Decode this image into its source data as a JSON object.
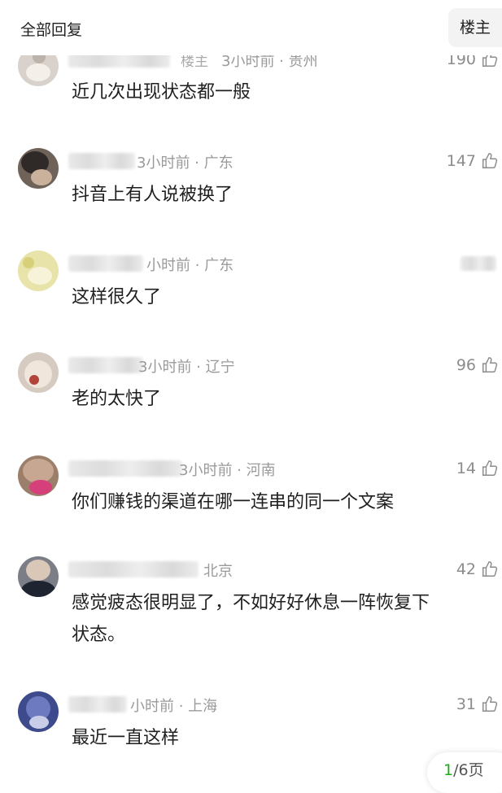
{
  "header": {
    "title": "全部回复",
    "owner_button": "楼主"
  },
  "comments": [
    {
      "badge": "楼主",
      "meta": "3小时前 · 贵州",
      "text": "近几次出现状态都一般",
      "likes": "190"
    },
    {
      "meta": "3小时前 · 广东",
      "text": "抖音上有人说被换了",
      "likes": "147"
    },
    {
      "meta": "小时前 · 广东",
      "text": "这样很久了",
      "likes": ""
    },
    {
      "meta": "3小时前 · 辽宁",
      "text": "老的太快了",
      "likes": "96"
    },
    {
      "meta": "3小时前 · 河南",
      "text": "你们赚钱的渠道在哪一连串的同一个文案",
      "likes": "14"
    },
    {
      "meta": "北京",
      "text_line1": "感觉疲态很明显了，不如好好休息一阵恢复下",
      "text_line2": "状态。",
      "likes": "42"
    },
    {
      "meta": "小时前 · 上海",
      "text": "最近一直这样",
      "likes": "31"
    }
  ],
  "pager": {
    "current": "1",
    "total": "/6页"
  },
  "icons": {
    "like": "thumbs-up-icon"
  },
  "colors": {
    "accent": "#1aad19",
    "meta_text": "#9a9a9a"
  }
}
